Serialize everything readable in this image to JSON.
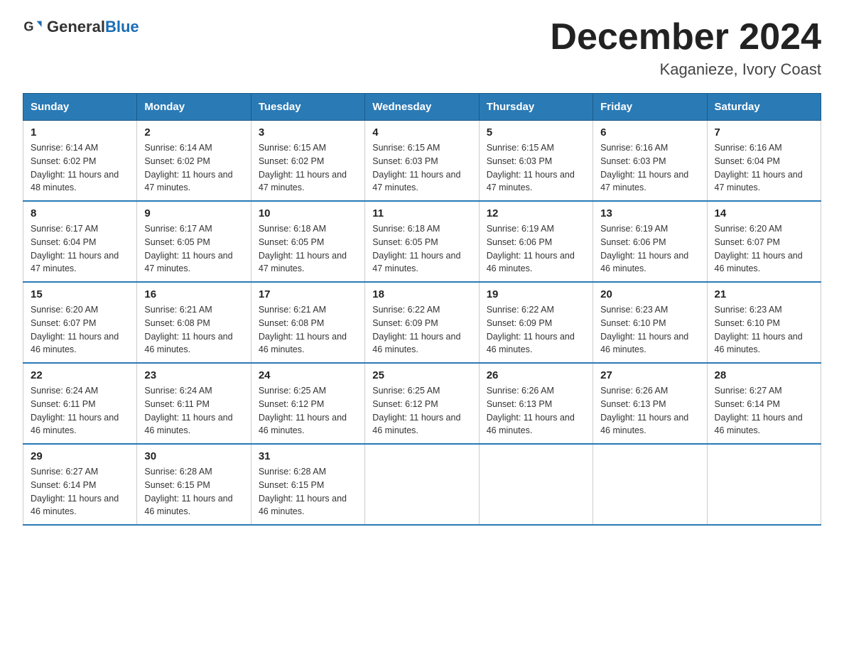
{
  "header": {
    "logo_general": "General",
    "logo_blue": "Blue",
    "month_title": "December 2024",
    "location": "Kaganieze, Ivory Coast"
  },
  "days_of_week": [
    "Sunday",
    "Monday",
    "Tuesday",
    "Wednesday",
    "Thursday",
    "Friday",
    "Saturday"
  ],
  "weeks": [
    [
      {
        "day": "1",
        "sunrise": "6:14 AM",
        "sunset": "6:02 PM",
        "daylight": "11 hours and 48 minutes."
      },
      {
        "day": "2",
        "sunrise": "6:14 AM",
        "sunset": "6:02 PM",
        "daylight": "11 hours and 47 minutes."
      },
      {
        "day": "3",
        "sunrise": "6:15 AM",
        "sunset": "6:02 PM",
        "daylight": "11 hours and 47 minutes."
      },
      {
        "day": "4",
        "sunrise": "6:15 AM",
        "sunset": "6:03 PM",
        "daylight": "11 hours and 47 minutes."
      },
      {
        "day": "5",
        "sunrise": "6:15 AM",
        "sunset": "6:03 PM",
        "daylight": "11 hours and 47 minutes."
      },
      {
        "day": "6",
        "sunrise": "6:16 AM",
        "sunset": "6:03 PM",
        "daylight": "11 hours and 47 minutes."
      },
      {
        "day": "7",
        "sunrise": "6:16 AM",
        "sunset": "6:04 PM",
        "daylight": "11 hours and 47 minutes."
      }
    ],
    [
      {
        "day": "8",
        "sunrise": "6:17 AM",
        "sunset": "6:04 PM",
        "daylight": "11 hours and 47 minutes."
      },
      {
        "day": "9",
        "sunrise": "6:17 AM",
        "sunset": "6:05 PM",
        "daylight": "11 hours and 47 minutes."
      },
      {
        "day": "10",
        "sunrise": "6:18 AM",
        "sunset": "6:05 PM",
        "daylight": "11 hours and 47 minutes."
      },
      {
        "day": "11",
        "sunrise": "6:18 AM",
        "sunset": "6:05 PM",
        "daylight": "11 hours and 47 minutes."
      },
      {
        "day": "12",
        "sunrise": "6:19 AM",
        "sunset": "6:06 PM",
        "daylight": "11 hours and 46 minutes."
      },
      {
        "day": "13",
        "sunrise": "6:19 AM",
        "sunset": "6:06 PM",
        "daylight": "11 hours and 46 minutes."
      },
      {
        "day": "14",
        "sunrise": "6:20 AM",
        "sunset": "6:07 PM",
        "daylight": "11 hours and 46 minutes."
      }
    ],
    [
      {
        "day": "15",
        "sunrise": "6:20 AM",
        "sunset": "6:07 PM",
        "daylight": "11 hours and 46 minutes."
      },
      {
        "day": "16",
        "sunrise": "6:21 AM",
        "sunset": "6:08 PM",
        "daylight": "11 hours and 46 minutes."
      },
      {
        "day": "17",
        "sunrise": "6:21 AM",
        "sunset": "6:08 PM",
        "daylight": "11 hours and 46 minutes."
      },
      {
        "day": "18",
        "sunrise": "6:22 AM",
        "sunset": "6:09 PM",
        "daylight": "11 hours and 46 minutes."
      },
      {
        "day": "19",
        "sunrise": "6:22 AM",
        "sunset": "6:09 PM",
        "daylight": "11 hours and 46 minutes."
      },
      {
        "day": "20",
        "sunrise": "6:23 AM",
        "sunset": "6:10 PM",
        "daylight": "11 hours and 46 minutes."
      },
      {
        "day": "21",
        "sunrise": "6:23 AM",
        "sunset": "6:10 PM",
        "daylight": "11 hours and 46 minutes."
      }
    ],
    [
      {
        "day": "22",
        "sunrise": "6:24 AM",
        "sunset": "6:11 PM",
        "daylight": "11 hours and 46 minutes."
      },
      {
        "day": "23",
        "sunrise": "6:24 AM",
        "sunset": "6:11 PM",
        "daylight": "11 hours and 46 minutes."
      },
      {
        "day": "24",
        "sunrise": "6:25 AM",
        "sunset": "6:12 PM",
        "daylight": "11 hours and 46 minutes."
      },
      {
        "day": "25",
        "sunrise": "6:25 AM",
        "sunset": "6:12 PM",
        "daylight": "11 hours and 46 minutes."
      },
      {
        "day": "26",
        "sunrise": "6:26 AM",
        "sunset": "6:13 PM",
        "daylight": "11 hours and 46 minutes."
      },
      {
        "day": "27",
        "sunrise": "6:26 AM",
        "sunset": "6:13 PM",
        "daylight": "11 hours and 46 minutes."
      },
      {
        "day": "28",
        "sunrise": "6:27 AM",
        "sunset": "6:14 PM",
        "daylight": "11 hours and 46 minutes."
      }
    ],
    [
      {
        "day": "29",
        "sunrise": "6:27 AM",
        "sunset": "6:14 PM",
        "daylight": "11 hours and 46 minutes."
      },
      {
        "day": "30",
        "sunrise": "6:28 AM",
        "sunset": "6:15 PM",
        "daylight": "11 hours and 46 minutes."
      },
      {
        "day": "31",
        "sunrise": "6:28 AM",
        "sunset": "6:15 PM",
        "daylight": "11 hours and 46 minutes."
      },
      null,
      null,
      null,
      null
    ]
  ]
}
